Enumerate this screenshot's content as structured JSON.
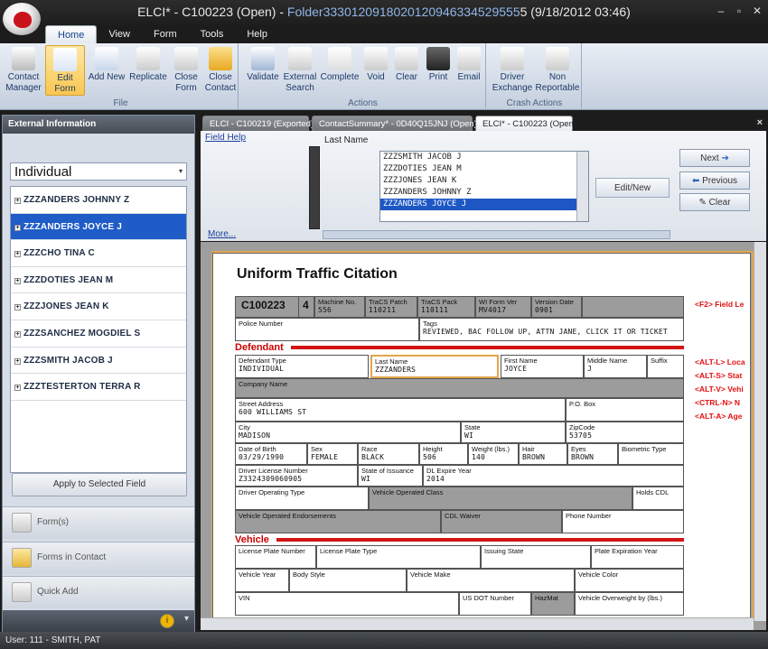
{
  "window": {
    "title_prefix": "ELCI* - C100223 (Open) - ",
    "title_folder": "Folder3330120918020120946334529555",
    "title_suffix": "5 (9/18/2012 03:46)",
    "min": "–",
    "restore": "▫",
    "close": "✕"
  },
  "menu": [
    "Home",
    "View",
    "Form",
    "Tools",
    "Help"
  ],
  "ribbon": {
    "file_group": "File",
    "actions_group": "Actions",
    "crash_group": "Crash Actions",
    "file_buttons": [
      "Contact Manager",
      "Edit Form",
      "Add New",
      "Replicate",
      "Close Form",
      "Close Contact"
    ],
    "action_buttons": [
      "Validate",
      "External Search",
      "Complete",
      "Void",
      "Clear",
      "Print",
      "Email"
    ],
    "crash_buttons": [
      "Driver Exchange",
      "Non Reportable"
    ]
  },
  "left_panel": {
    "header": "External Information",
    "selector": "Individual",
    "people": [
      "ZZZANDERS JOHNNY Z",
      "ZZZANDERS JOYCE J",
      "ZZZCHO TINA C",
      "ZZZDOTIES JEAN M",
      "ZZZJONES JEAN K",
      "ZZZSANCHEZ MOGDIEL S",
      "ZZZSMITH JACOB J",
      "ZZZTESTERTON TERRA R"
    ],
    "selected_index": 1,
    "apply_label": "Apply to Selected Field",
    "nav": [
      "Form(s)",
      "Forms in Contact",
      "Quick Add"
    ],
    "info_icon": "i",
    "chevron": "▾"
  },
  "doc_tabs": [
    "ELCI - C100219 (Exported)",
    "ContactSummary* - 0D40Q15JNJ (Open)",
    "ELCI* - C100223 (Open)"
  ],
  "doc_close": "×",
  "search": {
    "field_help": "Field Help",
    "more": "More...",
    "last_name_label": "Last Name",
    "results": [
      "ZZZSMITH JACOB J",
      "ZZZDOTIES JEAN M",
      "ZZZJONES JEAN K",
      "ZZZANDERS JOHNNY Z",
      "ZZZANDERS JOYCE J"
    ],
    "selected_result": 4,
    "edit_new": "Edit/New",
    "next": "Next",
    "previous": "Previous",
    "clear": "Clear"
  },
  "form": {
    "title": "Uniform Traffic Citation",
    "citation_no": "C100223",
    "copy_no": "4",
    "machine_no_label": "Machine No.",
    "machine_no": "556",
    "tracs_patch_label": "TraCS Patch",
    "tracs_patch": "110211",
    "tracs_pack_label": "TraCS Pack",
    "tracs_pack": "110111",
    "wi_form_ver_label": "WI Form Ver",
    "wi_form_ver": "MV4017",
    "version_date_label": "Version Date",
    "version_date": "0901",
    "police_number_label": "Police Number",
    "tags_label": "Tags",
    "tags": "REVIEWED, BAC FOLLOW UP, ATTN JANE, CLICK IT OR TICKET",
    "defendant_section": "Defendant",
    "defendant_type_label": "Defendant Type",
    "defendant_type": "INDIVIDUAL",
    "last_name_label": "Last Name",
    "last_name": "ZZZANDERS",
    "first_name_label": "First Name",
    "first_name": "JOYCE",
    "middle_name_label": "Middle Name",
    "middle_name": "J",
    "suffix_label": "Suffix",
    "company_name_label": "Company Name",
    "street_label": "Street Address",
    "street": "600 WILLIAMS ST",
    "po_box_label": "P.O. Box",
    "city_label": "City",
    "city": "MADISON",
    "state_label": "State",
    "state": "WI",
    "zip_label": "ZipCode",
    "zip": "53705",
    "dob_label": "Date of Birth",
    "dob": "03/29/1990",
    "sex_label": "Sex",
    "sex": "FEMALE",
    "race_label": "Race",
    "race": "BLACK",
    "height_label": "Height",
    "height": "506",
    "weight_label": "Weight (lbs.)",
    "weight": "140",
    "hair_label": "Hair",
    "hair": "BROWN",
    "eyes_label": "Eyes",
    "eyes": "BROWN",
    "biometric_label": "Biometric Type",
    "license_label": "Driver License Number",
    "license": "Z3324309060905",
    "issuance_label": "State of Issuance",
    "issuance": "WI",
    "dl_expire_label": "DL Expire Year",
    "dl_expire": "2014",
    "op_type_label": "Driver Operating Type",
    "op_class_label": "Vehicle Operated Class",
    "holds_cdl_label": "Holds CDL",
    "endorsements_label": "Vehicle Operated Endorsements",
    "cdl_waiver_label": "CDL Waiver",
    "phone_label": "Phone Number",
    "vehicle_section": "Vehicle",
    "plate_label": "License Plate Number",
    "plate_type_label": "License Plate Type",
    "issuing_state_label": "Issuing State",
    "plate_exp_label": "Plate Expiration Year",
    "veh_year_label": "Vehicle Year",
    "body_style_label": "Body Style",
    "veh_make_label": "Vehicle Make",
    "veh_color_label": "Vehicle Color",
    "vin_label": "VIN",
    "usdot_label": "US DOT Number",
    "hazmat_label": "HazMat",
    "overweight_label": "Vehicle Overweight by (lbs.)",
    "hints": [
      "<F2> Field Le",
      "<ALT-L> Loca",
      "<ALT-S> Stat",
      "<ALT-V> Vehi",
      "<CTRL-N> N",
      "<ALT-A> Age"
    ]
  },
  "status": "User: 111 - SMITH, PAT"
}
